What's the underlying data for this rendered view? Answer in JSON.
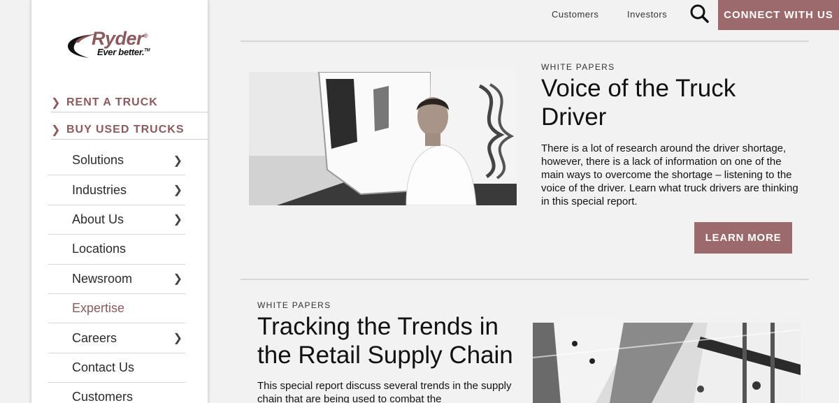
{
  "logo": {
    "word": "Ryder",
    "tagline": "Ever better.",
    "reg": "®",
    "tm": "TM"
  },
  "sidebar": {
    "cta": [
      {
        "label": "RENT A TRUCK"
      },
      {
        "label": "BUY USED TRUCKS"
      }
    ],
    "items": [
      {
        "label": "Solutions",
        "chevron": true
      },
      {
        "label": "Industries",
        "chevron": true
      },
      {
        "label": "About Us",
        "chevron": true
      },
      {
        "label": "Locations",
        "chevron": false
      },
      {
        "label": "Newsroom",
        "chevron": true
      },
      {
        "label": "Expertise",
        "chevron": false,
        "active": true
      },
      {
        "label": "Careers",
        "chevron": true
      },
      {
        "label": "Contact Us",
        "chevron": false
      },
      {
        "label": "Customers",
        "chevron": false
      }
    ]
  },
  "header": {
    "links": [
      "Customers",
      "Investors"
    ],
    "connect_label": "CONNECT WITH US"
  },
  "articles": [
    {
      "eyebrow": "WHITE PAPERS",
      "title_line1": "Voice of the Truck",
      "title_line2": "Driver",
      "body": "There is a lot of research around the driver shortage, however, there is a lack of information on one of the main ways to overcome the shortage – listening to the voice of the driver. Learn what truck drivers are thinking in this special report.",
      "button": "LEARN MORE"
    },
    {
      "eyebrow": "WHITE PAPERS",
      "title_line1": "Tracking the Trends in",
      "title_line2": "the Retail Supply Chain",
      "body": "This special report discuss several trends in the supply chain that are being used to combat the"
    }
  ],
  "colors": {
    "brand": "#9c6a6d",
    "brand_text": "#8c5a5c",
    "divider": "#d6d6d6"
  },
  "icons": {
    "search": "search-icon",
    "chevron": "chevron-right-icon"
  }
}
